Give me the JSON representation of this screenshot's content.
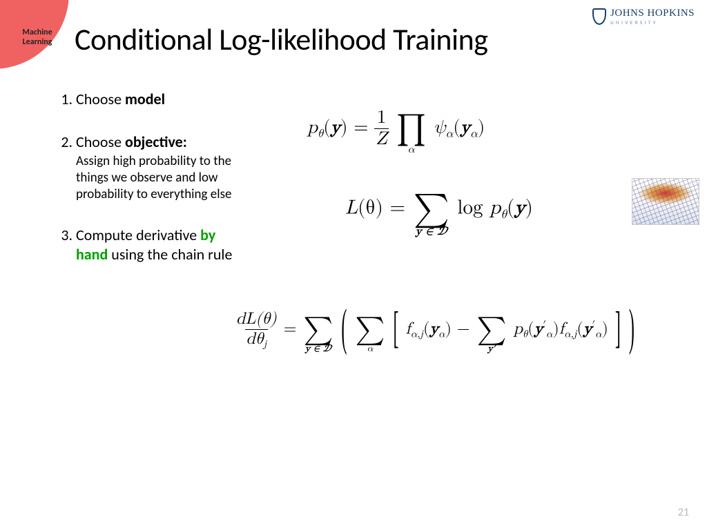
{
  "badge": {
    "line1": "Machine",
    "line2": "Learning"
  },
  "logo": {
    "main": "JOHNS HOPKINS",
    "sub": "UNIVERSITY"
  },
  "title": "Conditional Log-likelihood Training",
  "steps": {
    "s1": {
      "lead": "Choose ",
      "strong": "model"
    },
    "s2": {
      "lead": "Choose ",
      "strong": "objective:",
      "detail": "Assign high probability to the things we observe and low probability to everything else"
    },
    "s3": {
      "lead1": "Compute derivative ",
      "byhand": "by hand",
      "lead2": " using the chain rule"
    }
  },
  "equations": {
    "e1_lhs_p": "p",
    "e1_lhs_sub": "θ",
    "e1_lhs_arg_l": "(",
    "e1_lhs_y": "y",
    "e1_lhs_arg_r": ") = ",
    "e1_frac_num": "1",
    "e1_frac_den": "Z",
    "e1_prod": "∏",
    "e1_prod_sub": "α",
    "e1_psi": " ψ",
    "e1_psi_sub": "α",
    "e1_psi_l": "(",
    "e1_psi_y": "y",
    "e1_psi_ysub": "α",
    "e1_psi_r": ")",
    "e2_L": "L",
    "e2_Larg": "(θ) = ",
    "e2_sum": "∑",
    "e2_sum_sub": "y ∈ 𝒟",
    "e2_log": " log ",
    "e2_p": "p",
    "e2_psub": "θ",
    "e2_pl": "(",
    "e2_py": "y",
    "e2_pr": ")",
    "e3_frac_num_d": "dL(θ)",
    "e3_frac_den_d": "dθ",
    "e3_frac_den_sub": "j",
    "e3_eq": " = ",
    "e3_sum1": "∑",
    "e3_sum1_sub": "y ∈ 𝒟",
    "e3_lparen": "(",
    "e3_sum2": "∑",
    "e3_sum2_sub": "α",
    "e3_lbrack": "[",
    "e3_f1": "f",
    "e3_f1_sub": "α,j",
    "e3_f1_l": "(",
    "e3_f1_y": "y",
    "e3_f1_ysub": "α",
    "e3_f1_r": ")",
    "e3_minus": " − ",
    "e3_sum3": "∑",
    "e3_sum3_sub": "y′",
    "e3_p": "p",
    "e3_psub": "θ",
    "e3_pl": "(",
    "e3_py": "y",
    "e3_pysup": "′",
    "e3_pysub": "α",
    "e3_pr": ")",
    "e3_f2": "f",
    "e3_f2_sub": "α,j",
    "e3_f2_l": "(",
    "e3_f2_y": "y",
    "e3_f2_ysup": "′",
    "e3_f2_ysub": "α",
    "e3_f2_r": ")",
    "e3_rbrack": "]",
    "e3_rparen": ")"
  },
  "page_number": "21"
}
